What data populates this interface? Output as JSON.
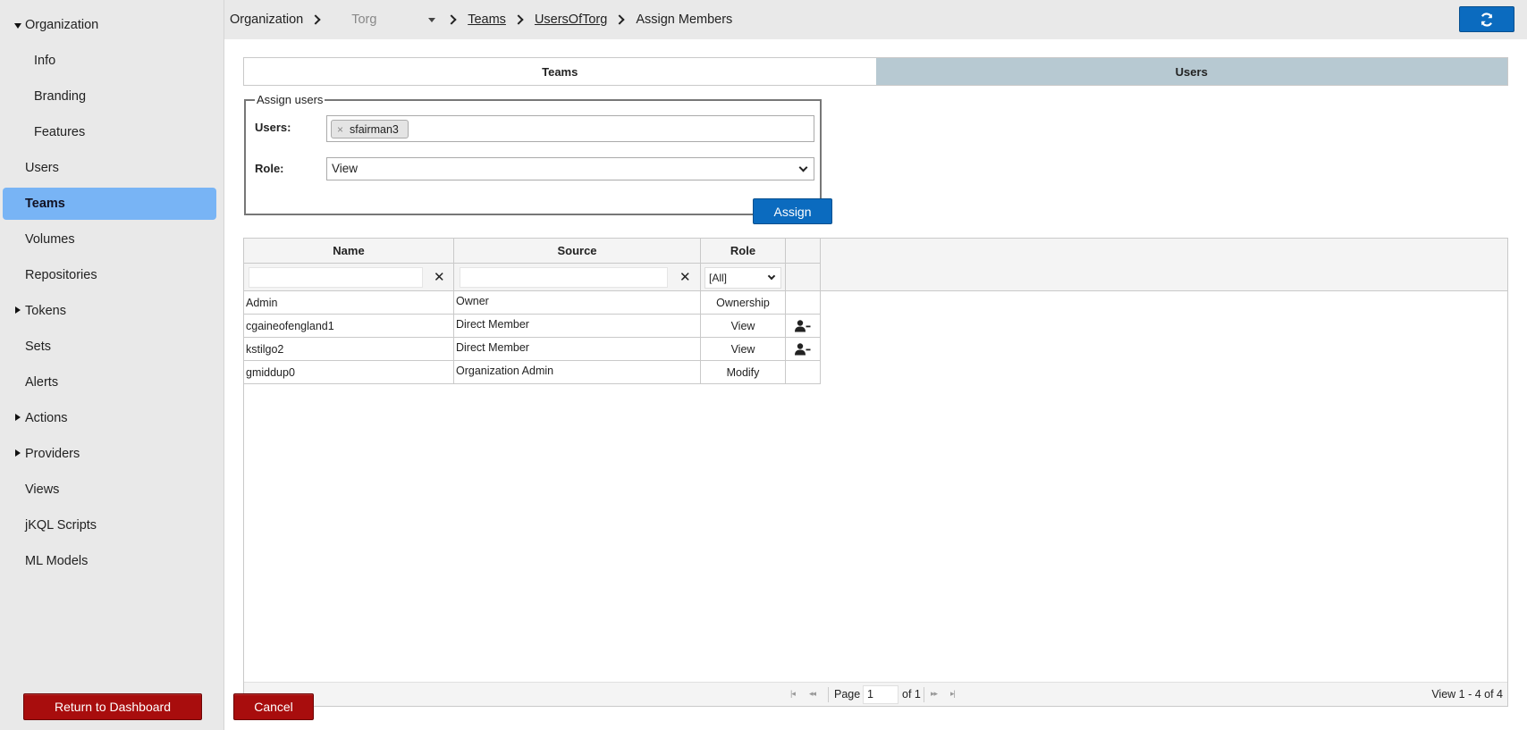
{
  "sidebar": {
    "items": [
      {
        "label": "Organization",
        "expander": "open",
        "sub": false,
        "active": false
      },
      {
        "label": "Info",
        "expander": "none",
        "sub": true,
        "active": false
      },
      {
        "label": "Branding",
        "expander": "none",
        "sub": true,
        "active": false
      },
      {
        "label": "Features",
        "expander": "none",
        "sub": true,
        "active": false
      },
      {
        "label": "Users",
        "expander": "none",
        "sub": false,
        "active": false
      },
      {
        "label": "Teams",
        "expander": "none",
        "sub": false,
        "active": true
      },
      {
        "label": "Volumes",
        "expander": "none",
        "sub": false,
        "active": false
      },
      {
        "label": "Repositories",
        "expander": "none",
        "sub": false,
        "active": false
      },
      {
        "label": "Tokens",
        "expander": "closed",
        "sub": false,
        "active": false
      },
      {
        "label": "Sets",
        "expander": "none",
        "sub": false,
        "active": false
      },
      {
        "label": "Alerts",
        "expander": "none",
        "sub": false,
        "active": false
      },
      {
        "label": "Actions",
        "expander": "closed",
        "sub": false,
        "active": false
      },
      {
        "label": "Providers",
        "expander": "closed",
        "sub": false,
        "active": false
      },
      {
        "label": "Views",
        "expander": "none",
        "sub": false,
        "active": false
      },
      {
        "label": "jKQL Scripts",
        "expander": "none",
        "sub": false,
        "active": false
      },
      {
        "label": "ML Models",
        "expander": "none",
        "sub": false,
        "active": false
      }
    ],
    "return_label": "Return to Dashboard"
  },
  "header": {
    "crumb_org": "Organization",
    "org_select": "Torg",
    "crumb_teams": "Teams",
    "crumb_team": "UsersOfTorg",
    "crumb_current": "Assign Members",
    "refresh_icon": "refresh-icon"
  },
  "tabs": {
    "teams": "Teams",
    "users": "Users"
  },
  "assign": {
    "legend": "Assign users",
    "users_label": "Users:",
    "selected_user": "sfairman3",
    "chip_remove": "×",
    "role_label": "Role:",
    "role_value": "View",
    "assign_button": "Assign"
  },
  "grid": {
    "columns": {
      "name": "Name",
      "source": "Source",
      "role": "Role"
    },
    "clear_symbol": "✕",
    "role_filter": "[All]",
    "rows": [
      {
        "name": "Admin",
        "source": "Owner",
        "role": "Ownership",
        "removable": false
      },
      {
        "name": "cgaineofengland1",
        "source": "Direct Member",
        "role": "View",
        "removable": true
      },
      {
        "name": "kstilgo2",
        "source": "Direct Member",
        "role": "View",
        "removable": true
      },
      {
        "name": "gmiddup0",
        "source": "Organization Admin",
        "role": "Modify",
        "removable": false
      }
    ],
    "pager": {
      "page_label": "Page",
      "page_value": "1",
      "of_label": "of 1",
      "view_count": "View 1 - 4 of 4"
    }
  },
  "footer": {
    "cancel_label": "Cancel"
  },
  "colors": {
    "active_nav": "#78b4f5",
    "primary_button": "#0b6bbf",
    "danger_button": "#a80d0d",
    "inactive_tab": "#b7c9d2"
  }
}
